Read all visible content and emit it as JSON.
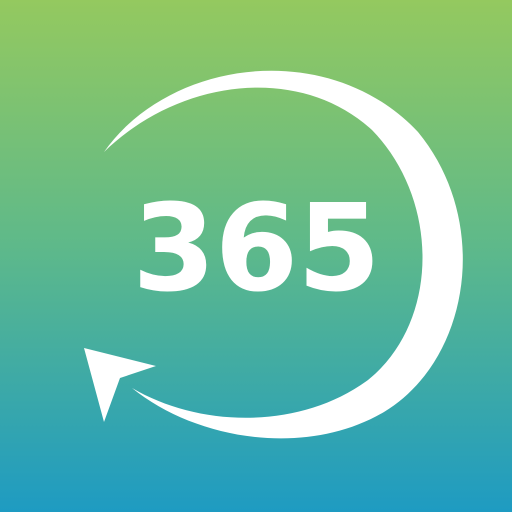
{
  "icon": {
    "number": "365",
    "colors": {
      "gradient_top": "#94C95F",
      "gradient_middle": "#5EB98A",
      "gradient_bottom": "#1E9BC2",
      "foreground": "#FFFFFF"
    },
    "symbol": "circular-refresh-arrow-icon"
  }
}
